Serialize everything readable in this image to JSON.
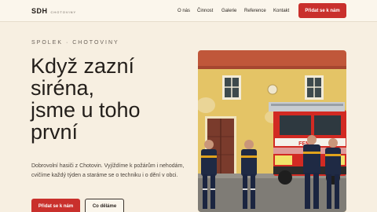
{
  "header": {
    "logo_main": "SDH",
    "logo_sub": "CHOTOVINY",
    "nav": [
      "O nás",
      "Činnost",
      "Galerie",
      "Reference",
      "Kontakt"
    ],
    "cta": "Přidat se k nám"
  },
  "hero": {
    "eyebrow": "SPOLEK · CHOTOVINY",
    "headline_lines": [
      "Když zazní",
      "siréna,",
      "jsme u toho",
      "první"
    ],
    "description": "Dobrovolní hasiči z Chotovin. Vyjíždíme k požárům i nehodám, cvičíme každý týden a staráme se o techniku i o dění v obci.",
    "primary_button": "Přidat se k nám",
    "secondary_button": "Co děláme",
    "photo_truck_label": "FEMA"
  },
  "colors": {
    "accent": "#c9302c",
    "background": "#f7efe1",
    "header_bg": "#fbf6ec"
  }
}
